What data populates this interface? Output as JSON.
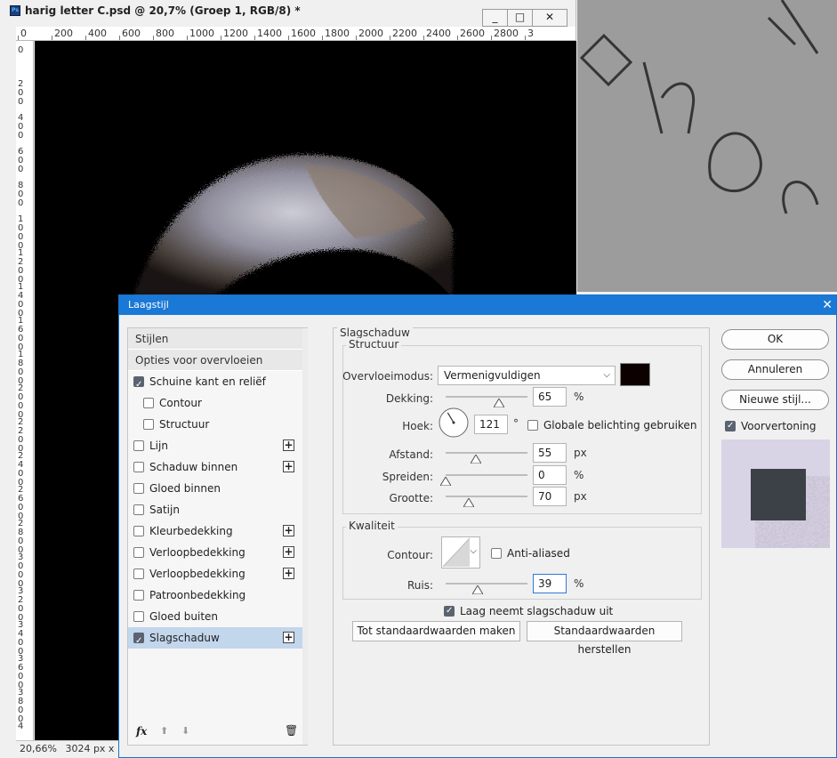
{
  "document": {
    "title": "harig letter C.psd @ 20,7% (Groep 1, RGB/8) *",
    "app_icon": "Ps",
    "window_buttons": {
      "minimize": "_",
      "maximize": "□",
      "close": "✕"
    },
    "ruler_top_labels": [
      "0",
      "200",
      "400",
      "600",
      "800",
      "1000",
      "1200",
      "1400",
      "1600",
      "1800",
      "2000",
      "2200",
      "2400",
      "2600",
      "2800",
      "3"
    ],
    "ruler_left_labels": [
      "0",
      "2 0 0",
      "4 0 0",
      "6 0 0",
      "8 0 0",
      "1 0 0 0",
      "1 2 0 0",
      "1 4 0 0",
      "1 6 0 0",
      "1 8 0 0",
      "2 0 0 0",
      "2 2 0 0",
      "2 4 0 0",
      "2 6 0 0",
      "2 8 0 0",
      "3 0 0 0",
      "3 2 0 0",
      "3 4 0 0",
      "3 6 0 0",
      "3 8 0 0",
      "4"
    ],
    "status_zoom": "20,66%",
    "status_info": "3024 px x"
  },
  "dialog": {
    "title": "Laagstijl",
    "close_glyph": "✕",
    "style_list": {
      "header_styles": "Stijlen",
      "header_blend": "Opties voor overvloeien",
      "items": [
        {
          "label": "Schuine kant en reliëf",
          "checked": true,
          "plus": false,
          "indent": false
        },
        {
          "label": "Contour",
          "checked": false,
          "plus": false,
          "indent": true
        },
        {
          "label": "Structuur",
          "checked": false,
          "plus": false,
          "indent": true
        },
        {
          "label": "Lijn",
          "checked": false,
          "plus": true,
          "indent": false
        },
        {
          "label": "Schaduw binnen",
          "checked": false,
          "plus": true,
          "indent": false
        },
        {
          "label": "Gloed binnen",
          "checked": false,
          "plus": false,
          "indent": false
        },
        {
          "label": "Satijn",
          "checked": false,
          "plus": false,
          "indent": false
        },
        {
          "label": "Kleurbedekking",
          "checked": false,
          "plus": true,
          "indent": false
        },
        {
          "label": "Verloopbedekking",
          "checked": false,
          "plus": true,
          "indent": false
        },
        {
          "label": "Verloopbedekking",
          "checked": false,
          "plus": true,
          "indent": false
        },
        {
          "label": "Patroonbedekking",
          "checked": false,
          "plus": false,
          "indent": false
        },
        {
          "label": "Gloed buiten",
          "checked": false,
          "plus": false,
          "indent": false
        },
        {
          "label": "Slagschaduw",
          "checked": true,
          "plus": true,
          "indent": false,
          "selected": true
        }
      ],
      "fx_label": "fx",
      "up_glyph": "⬆",
      "down_glyph": "⬇",
      "trash_glyph": "🗑"
    },
    "drop_shadow": {
      "section_title": "Slagschaduw",
      "structure_title": "Structuur",
      "blend_mode_label": "Overvloeimodus:",
      "blend_mode_value": "Vermenigvuldigen",
      "shadow_color": "#0d0000",
      "opacity_label": "Dekking:",
      "opacity_value": "65",
      "opacity_unit": "%",
      "angle_label": "Hoek:",
      "angle_value": "121",
      "angle_unit": "°",
      "global_light_label": "Globale belichting gebruiken",
      "distance_label": "Afstand:",
      "distance_value": "55",
      "distance_unit": "px",
      "spread_label": "Spreiden:",
      "spread_value": "0",
      "spread_unit": "%",
      "size_label": "Grootte:",
      "size_value": "70",
      "size_unit": "px",
      "quality_title": "Kwaliteit",
      "contour_label": "Contour:",
      "antialiased_label": "Anti-aliased",
      "noise_label": "Ruis:",
      "noise_value": "39",
      "noise_unit": "%",
      "knockout_label": "Laag neemt slagschaduw uit",
      "make_default_button": "Tot standaardwaarden maken",
      "reset_default_button": "Standaardwaarden herstellen"
    },
    "right": {
      "ok_button": "OK",
      "cancel_button": "Annuleren",
      "new_style_button": "Nieuwe stijl...",
      "preview_label": "Voorvertoning"
    }
  },
  "colors": {
    "accent": "#1a78d6",
    "canvas": "#000000",
    "selected_row": "#c2d6ec"
  }
}
